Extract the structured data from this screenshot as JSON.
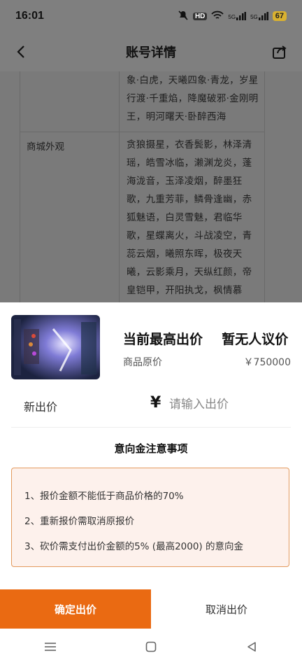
{
  "status_bar": {
    "time": "16:01",
    "hd_label": "HD",
    "signal1": "5G",
    "signal2": "5G",
    "battery": "67"
  },
  "header": {
    "title": "账号详情"
  },
  "background_table": {
    "row1_text": "象·白虎，天曦四象·青龙，岁星行渡·千重焰，降魔破邪·金刚明王，明河曙天·卧醉西海",
    "row2_label": "商城外观",
    "row2_text": "贪狼摄星，衣香鬓影，林泽清瑶，皓雪冰临，濑渊龙炎，蓬海泷音，玉泽凌烟，醉墨狂歌，九重芳菲，鳞骨逢幽，赤狐魅语，白灵雪魅，君临华歌，星蝶离火，斗战凌空，青蕊云烟，曦照东晖，极夜天曦，云影乘月，天纵红颜，帝皇铠甲，开阳执戈，枫情慕晚，广寒游仙，圣月澄空，金祈昼梦，兰亭觞咏，紫薇御"
  },
  "bid_sheet": {
    "highest_bid": "当前最高出价",
    "no_bid": "暂无人议价",
    "original_price_label": "商品原价",
    "original_price": "￥750000",
    "new_bid_label": "新出价",
    "currency_symbol": "¥",
    "input_placeholder": "请输入出价",
    "notice_title": "意向金注意事项",
    "notices": [
      "1、报价金额不能低于商品价格的70%",
      "2、重新报价需取消原报价",
      "3、砍价需支付出价金额的5% (最高2000) 的意向金"
    ],
    "confirm_label": "确定出价",
    "cancel_label": "取消出价"
  },
  "colors": {
    "accent": "#ea6a12",
    "notice_bg": "#fdf1ec",
    "notice_border": "#e3995c",
    "overlay": "#7f7f7f"
  },
  "icons": [
    "back-arrow-icon",
    "share-icon",
    "menu-icon",
    "home-icon",
    "back-triangle-icon",
    "mute-icon",
    "wifi-icon",
    "signal-icon"
  ]
}
